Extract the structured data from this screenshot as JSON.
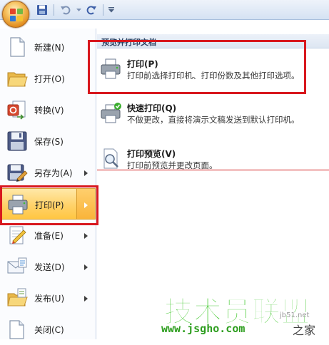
{
  "menu": {
    "items": [
      {
        "label": "新建(N)",
        "icon": "new-document-icon",
        "has_arrow": false
      },
      {
        "label": "打开(O)",
        "icon": "open-folder-icon",
        "has_arrow": false
      },
      {
        "label": "转换(V)",
        "icon": "convert-icon",
        "has_arrow": false
      },
      {
        "label": "保存(S)",
        "icon": "save-icon",
        "has_arrow": false
      },
      {
        "label": "另存为(A)",
        "icon": "save-as-icon",
        "has_arrow": true
      },
      {
        "label": "打印(P)",
        "icon": "printer-icon",
        "has_arrow": true,
        "selected": true
      },
      {
        "label": "准备(E)",
        "icon": "prepare-icon",
        "has_arrow": true
      },
      {
        "label": "发送(D)",
        "icon": "send-icon",
        "has_arrow": true
      },
      {
        "label": "发布(U)",
        "icon": "publish-icon",
        "has_arrow": true
      },
      {
        "label": "关闭(C)",
        "icon": "close-document-icon",
        "has_arrow": false
      }
    ]
  },
  "submenu": {
    "header": "预览并打印文档",
    "items": [
      {
        "title": "打印(P)",
        "desc": "打印前选择打印机、打印份数及其他打印选项。",
        "icon": "printer-icon"
      },
      {
        "title": "快速打印(Q)",
        "desc": "不做更改，直接将演示文稿发送到默认打印机。",
        "icon": "quick-print-icon"
      },
      {
        "title": "打印预览(V)",
        "desc": "打印前预览并更改页面。",
        "icon": "print-preview-icon"
      }
    ]
  },
  "watermark": {
    "main": "技术员联盟",
    "sub1": "jb51.net",
    "sub2": "www.jsgho.com",
    "sub3": "之家"
  },
  "colors": {
    "highlight_border": "#d8181e",
    "selected_bg": "#ffd269",
    "watermark_green": "#3fc72a"
  }
}
